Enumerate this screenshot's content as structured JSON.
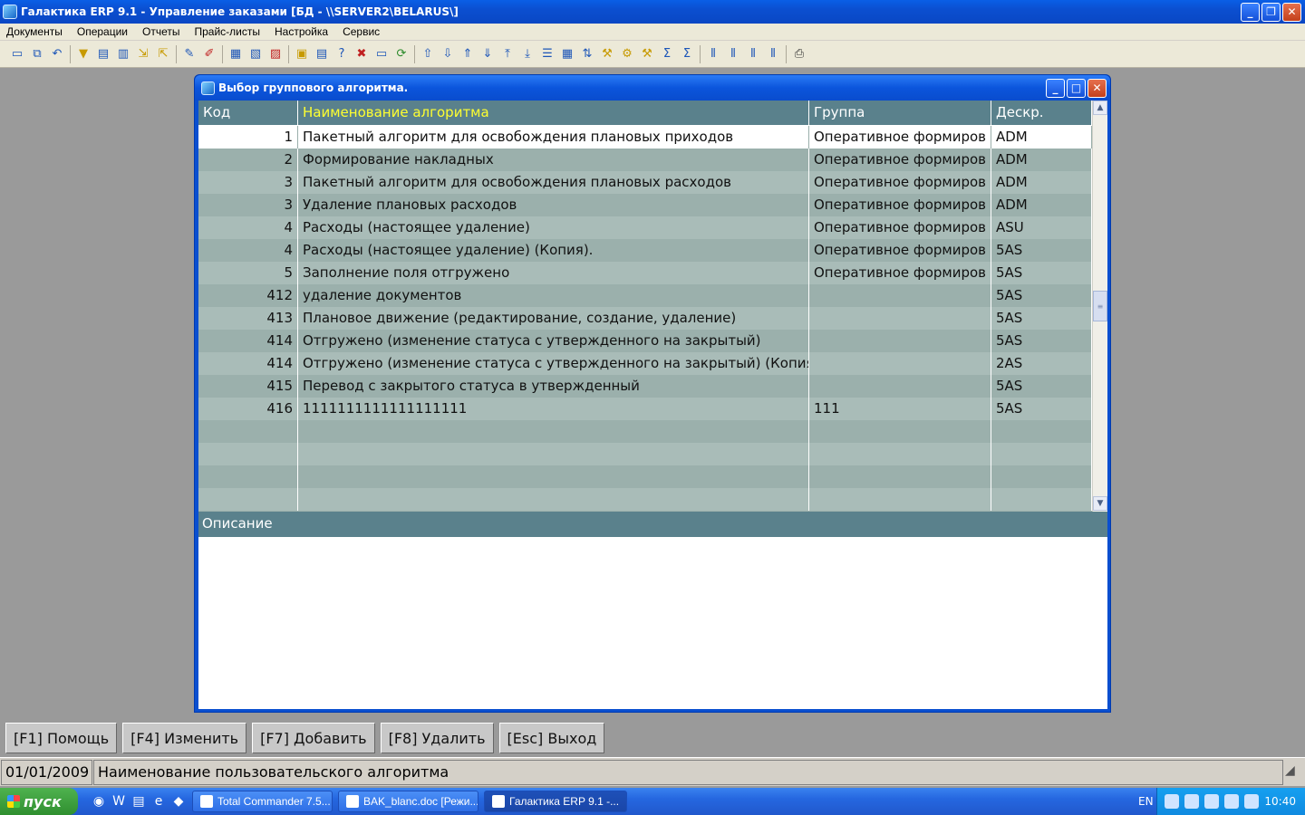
{
  "window": {
    "title": "Галактика ERP 9.1 - Управление заказами [БД - \\\\SERVER2\\BELARUS\\]"
  },
  "menu": [
    "Документы",
    "Операции",
    "Отчеты",
    "Прайс-листы",
    "Настройка",
    "Сервис"
  ],
  "toolbar": {
    "icons": [
      "new-doc-icon",
      "copy-icon",
      "undo-icon",
      "filter-icon",
      "filter-edit-icon",
      "report-icon",
      "export-icon",
      "import-icon",
      "edit-icon",
      "edit2-icon",
      "table-icon",
      "table-find-icon",
      "table-delete-icon",
      "calc-icon",
      "calc2-icon",
      "help-icon",
      "delete-icon",
      "window-icon",
      "refresh-icon",
      "arrow-up-icon",
      "arrow-down-icon",
      "arrow-up2-icon",
      "arrow-down2-icon",
      "first-icon",
      "last-icon",
      "list-icon",
      "grid-icon",
      "sort-icon",
      "tools-icon",
      "tools2-icon",
      "tools3-icon",
      "sigma-icon",
      "sigma2-icon",
      "col-icon",
      "col2-icon",
      "col3-icon",
      "col4-icon",
      "print-icon"
    ]
  },
  "dialog": {
    "title": "Выбор группового алгоритма.",
    "columns": [
      "Код",
      "Наименование алгоритма",
      "Группа",
      "Дескр."
    ],
    "rows": [
      {
        "code": "1",
        "name": "Пакетный алгоритм для освобождения плановых приходов",
        "group": "Оперативное формиров",
        "descr": "ADM"
      },
      {
        "code": "2",
        "name": "Формирование накладных",
        "group": "Оперативное формиров",
        "descr": "ADM"
      },
      {
        "code": "3",
        "name": "Пакетный алгоритм для освобождения плановых расходов",
        "group": "Оперативное формиров",
        "descr": "ADM"
      },
      {
        "code": "3",
        "name": "Удаление  плановых расходов",
        "group": "Оперативное формиров",
        "descr": "ADM"
      },
      {
        "code": "4",
        "name": "Расходы (настоящее удаление)",
        "group": "Оперативное формиров",
        "descr": "ASU"
      },
      {
        "code": "4",
        "name": "Расходы (настоящее удаление) (Копия).",
        "group": "Оперативное формиров",
        "descr": "5AS"
      },
      {
        "code": "5",
        "name": "Заполнение поля отгружено",
        "group": "Оперативное формиров",
        "descr": "5AS"
      },
      {
        "code": "412",
        "name": "удаление документов",
        "group": "",
        "descr": "5AS"
      },
      {
        "code": "413",
        "name": "Плановое движение (редактирование, создание, удаление)",
        "group": "",
        "descr": "5AS"
      },
      {
        "code": "414",
        "name": "Отгружено (изменение статуса с утвержденного  на закрытый)",
        "group": "",
        "descr": "5AS"
      },
      {
        "code": "414",
        "name": "Отгружено (изменение статуса с утвержденного  на закрытый) (Копия",
        "group": "",
        "descr": "2AS"
      },
      {
        "code": "415",
        "name": "Перевод с закрытого статуса в утвержденный",
        "group": "",
        "descr": "5AS"
      },
      {
        "code": "416",
        "name": "1111111111111111111",
        "group": "111",
        "descr": "5AS"
      }
    ],
    "description_label": "Описание"
  },
  "fkeys": [
    "[F1] Помощь",
    "[F4] Изменить",
    "[F7] Добавить",
    "[F8] Удалить",
    "[Esc] Выход"
  ],
  "status": {
    "date": "01/01/2009",
    "message": "Наименование пользовательского алгоритма"
  },
  "taskbar": {
    "start": "пуск",
    "tasks": [
      "Total Commander 7.5...",
      "BAK_blanc.doc [Режи...",
      "Галактика ERP 9.1 -..."
    ],
    "lang": "EN",
    "clock": "10:40"
  },
  "colors": {
    "header_bg": "#5a818c",
    "row_bg": "#a9bcb8",
    "active_header_text": "#ffff30"
  }
}
